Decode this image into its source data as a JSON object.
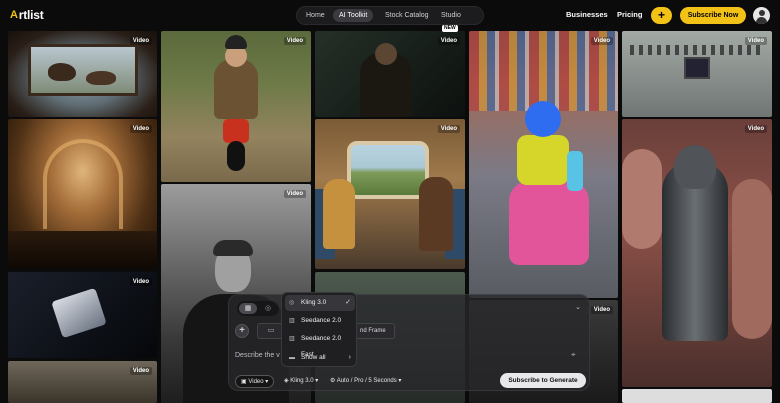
{
  "header": {
    "logo_mark": "A",
    "logo_word": "rtlist",
    "nav": {
      "home": "Home",
      "ai_toolkit": "AI Toolkit",
      "stock_catalog": "Stock Catalog",
      "studio": "Studio",
      "studio_badge": "NEW"
    },
    "businesses": "Businesses",
    "pricing": "Pricing",
    "plus": "+",
    "subscribe": "Subscribe Now"
  },
  "tile_tag": "Video",
  "generator": {
    "mode_a_icon": "grid-icon",
    "mode_b_icon": "circle-icon",
    "end_frame_fragment": "nd Frame",
    "prompt_placeholder": "Describe the v",
    "options": {
      "video": "Video",
      "model": "Kling 3.0",
      "settings": "Auto / Pro / 5 Seconds"
    },
    "subscribe_to_generate": "Subscribe to Generate"
  },
  "model_menu": {
    "items": [
      "Kling 3.0",
      "Seedance 2.0",
      "Seedance 2.0 Fast",
      "Show all"
    ],
    "selected": "Kling 3.0"
  },
  "colors": {
    "accent": "#f2c316",
    "background": "#0b0b0c"
  }
}
